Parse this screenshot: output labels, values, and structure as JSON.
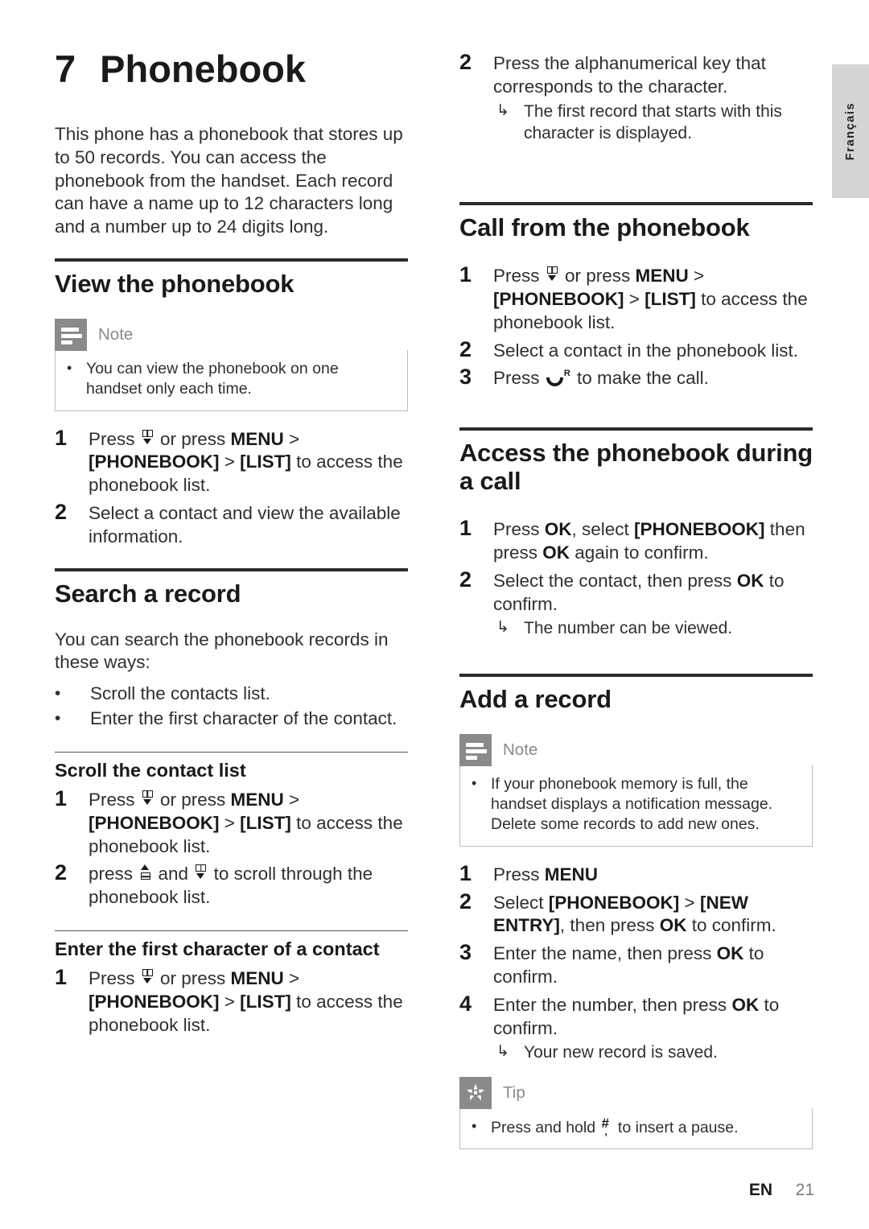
{
  "chapter": {
    "number": "7",
    "title": "Phonebook"
  },
  "intro": "This phone has a phonebook that stores up to 50 records. You can access the phonebook from the handset. Each record can have a name up to 12 characters long and a number up to 24 digits long.",
  "side_tab": {
    "label": "Français"
  },
  "footer": {
    "language": "EN",
    "page": "21"
  },
  "callout_labels": {
    "note": "Note",
    "tip": "Tip",
    "bullet": "•",
    "arrow": "↳"
  },
  "left_column": {
    "view": {
      "heading": "View the phonebook",
      "note": {
        "title": "Note",
        "items": [
          "You can view the phonebook on one handset only each time."
        ]
      },
      "steps": [
        {
          "index": "1",
          "pre": "Press ",
          "icon": "phonebook-key-icon",
          "mid": " or press ",
          "kw1": "MENU",
          "sep1": " > ",
          "kw2": "[PHONEBOOK]",
          "sep2": " > ",
          "kw3": "[LIST]",
          "post": " to access the phonebook list."
        },
        {
          "index": "2",
          "text": "Select a contact and view the available information."
        }
      ]
    },
    "search": {
      "heading": "Search a record",
      "intro": "You can search the phonebook records in these ways:",
      "bullets": [
        "Scroll the contacts list.",
        "Enter the first character of the contact."
      ],
      "scroll_sub": {
        "heading": "Scroll the contact list",
        "steps": [
          {
            "index": "1",
            "pre": "Press ",
            "icon": "phonebook-key-icon",
            "mid": " or press ",
            "kw1": "MENU",
            "sep1": " > ",
            "kw2": "[PHONEBOOK]",
            "sep2": " > ",
            "kw3": "[LIST]",
            "post": " to access the phonebook list."
          },
          {
            "index": "2",
            "pre": "press ",
            "icon_a": "up-key-icon",
            "mid": " and ",
            "icon_b": "phonebook-key-icon",
            "post": " to scroll through the phonebook list."
          }
        ]
      },
      "first_char_sub": {
        "heading": "Enter the first character of a contact",
        "steps": [
          {
            "index": "1",
            "pre": "Press ",
            "icon": "phonebook-key-icon",
            "mid": " or press ",
            "kw1": "MENU",
            "sep1": " > ",
            "kw2": "[PHONEBOOK]",
            "sep2": " > ",
            "kw3": "[LIST]",
            "post": " to access the phonebook list."
          }
        ]
      }
    }
  },
  "right_column": {
    "continued_step": {
      "index": "2",
      "text": "Press the alphanumerical key that corresponds to the character.",
      "result": "The first record that starts with this character is displayed."
    },
    "call_from": {
      "heading": "Call from the phonebook",
      "steps": [
        {
          "index": "1",
          "pre": "Press ",
          "icon": "phonebook-key-icon",
          "mid": " or press ",
          "kw1": "MENU",
          "sep1": " > ",
          "kw2": "[PHONEBOOK]",
          "sep2": " > ",
          "kw3": "[LIST]",
          "post": " to access the phonebook list."
        },
        {
          "index": "2",
          "text": "Select a contact in the phonebook list."
        },
        {
          "index": "3",
          "pre": "Press ",
          "icon": "call-key-icon",
          "post": " to make the call."
        }
      ]
    },
    "access_during_call": {
      "heading": "Access the phonebook during a call",
      "steps": [
        {
          "index": "1",
          "pre": "Press ",
          "kw1": "OK",
          "mid": ", select ",
          "kw2": "[PHONEBOOK]",
          "mid2": " then press ",
          "kw3": "OK",
          "post": " again to confirm."
        },
        {
          "index": "2",
          "pre": "Select the contact, then press ",
          "kw1": "OK",
          "post": " to confirm.",
          "result": "The number can be viewed."
        }
      ]
    },
    "add_record": {
      "heading": "Add a record",
      "note": {
        "title": "Note",
        "items": [
          "If your phonebook memory is full, the handset displays a notification message. Delete some records to add new ones."
        ]
      },
      "steps": [
        {
          "index": "1",
          "pre": "Press ",
          "kw1": "MENU"
        },
        {
          "index": "2",
          "pre": "Select ",
          "kw1": "[PHONEBOOK]",
          "sep1": " > ",
          "kw2": "[NEW ENTRY]",
          "mid": ", then press ",
          "kw3": "OK",
          "post": " to confirm."
        },
        {
          "index": "3",
          "pre": "Enter the name, then press ",
          "kw1": "OK",
          "post": " to confirm."
        },
        {
          "index": "4",
          "pre": "Enter the number, then press ",
          "kw1": "OK",
          "post": " to confirm.",
          "result": "Your new record is saved."
        }
      ],
      "tip": {
        "title": "Tip",
        "pre": "Press and hold ",
        "icon": "hash-key-icon",
        "post": " to insert a pause."
      }
    }
  },
  "colors": {
    "callout_icon_bg": "#8a8a8a",
    "callout_border": "#bdbdbd",
    "rule_major": "#2b2b2b",
    "side_tab_bg": "#d4d4d4",
    "text": "#2f2f2f",
    "heading": "#1a1a1a",
    "page_number": "#7d7d7d"
  }
}
